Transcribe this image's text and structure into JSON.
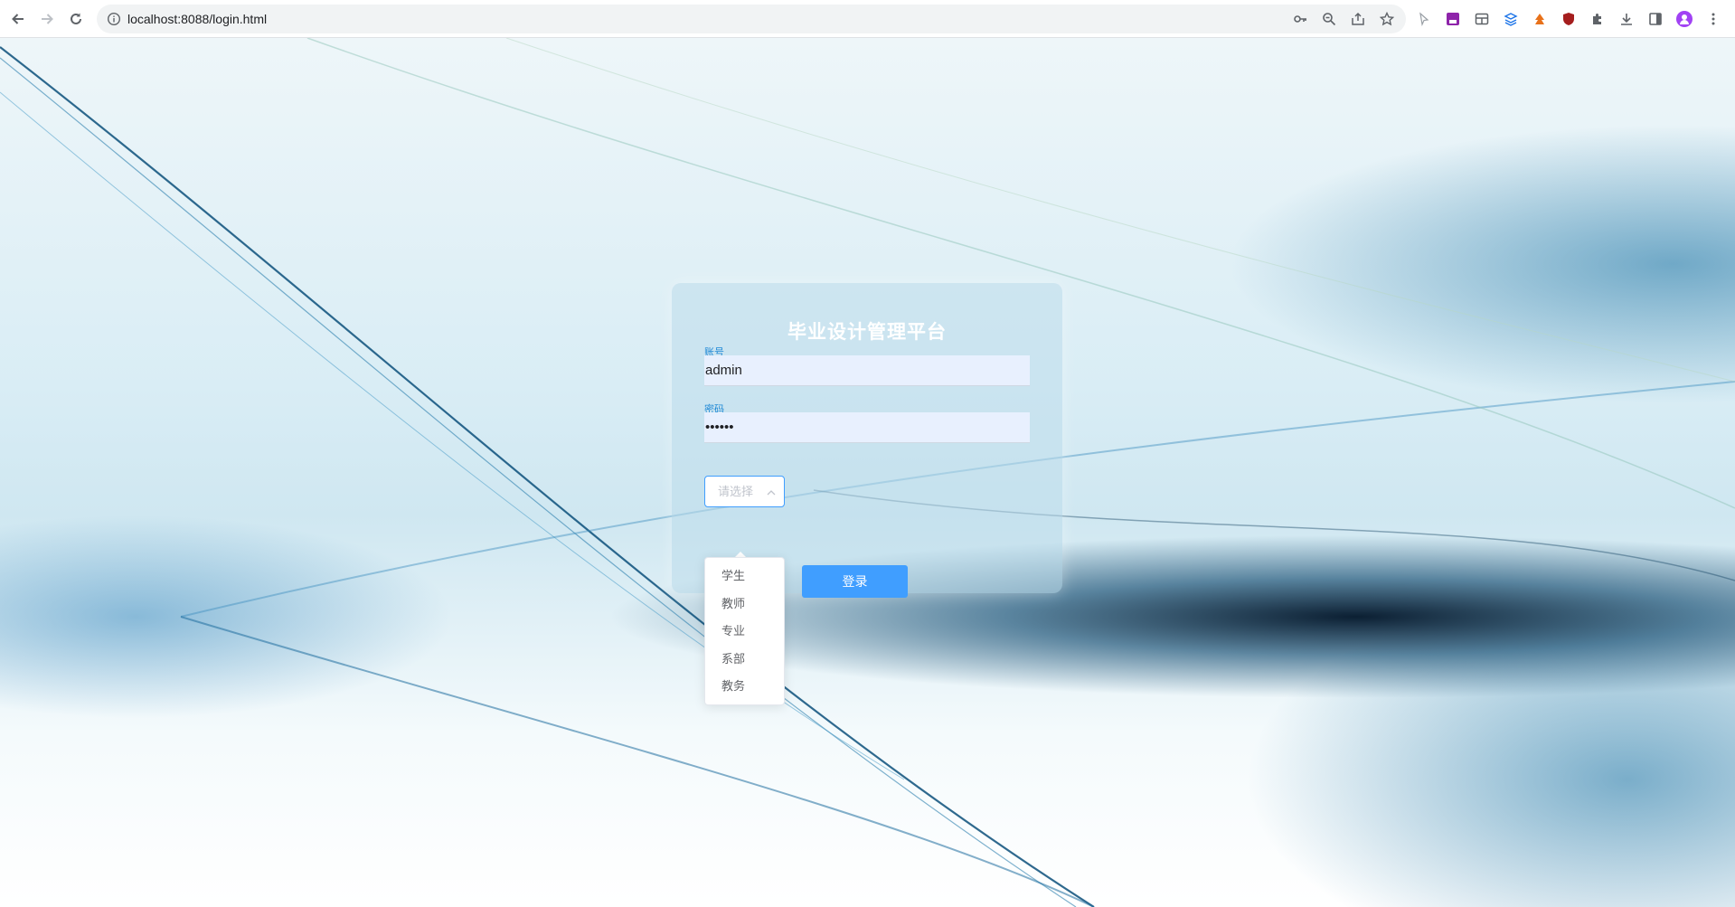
{
  "browser": {
    "url": "localhost:8088/login.html"
  },
  "login": {
    "title": "毕业设计管理平台",
    "account_label": "账号",
    "account_value": "admin",
    "password_label": "密码",
    "password_value": "••••••",
    "role_placeholder": "请选择",
    "login_button": "登录"
  },
  "role_options": [
    "学生",
    "教师",
    "专业",
    "系部",
    "教务"
  ],
  "colors": {
    "accent": "#409eff",
    "label": "#1e88d6",
    "input_bg": "#e8f0fe"
  }
}
